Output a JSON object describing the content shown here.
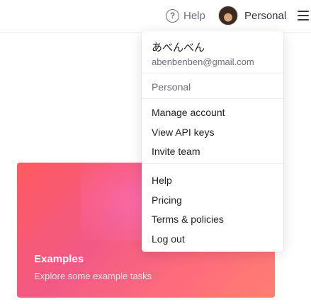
{
  "header": {
    "help_label": "Help",
    "help_icon": "question-circle-icon",
    "account_label": "Personal",
    "menu_icon": "hamburger-menu-icon"
  },
  "hero": {
    "title": "Examples",
    "subtitle": "Explore some example tasks"
  },
  "dropdown": {
    "user_name": "あべんべん",
    "user_email": "abenbenben@gmail.com",
    "org": "Personal",
    "account_items": [
      "Manage account",
      "View API keys",
      "Invite team"
    ],
    "misc_items": [
      "Help",
      "Pricing",
      "Terms & policies",
      "Log out"
    ]
  },
  "colors": {
    "accent_gradient_start": "#ff5a5f",
    "accent_gradient_mid": "#f25a86",
    "text_primary": "#202123",
    "text_secondary": "#6e6e80"
  }
}
